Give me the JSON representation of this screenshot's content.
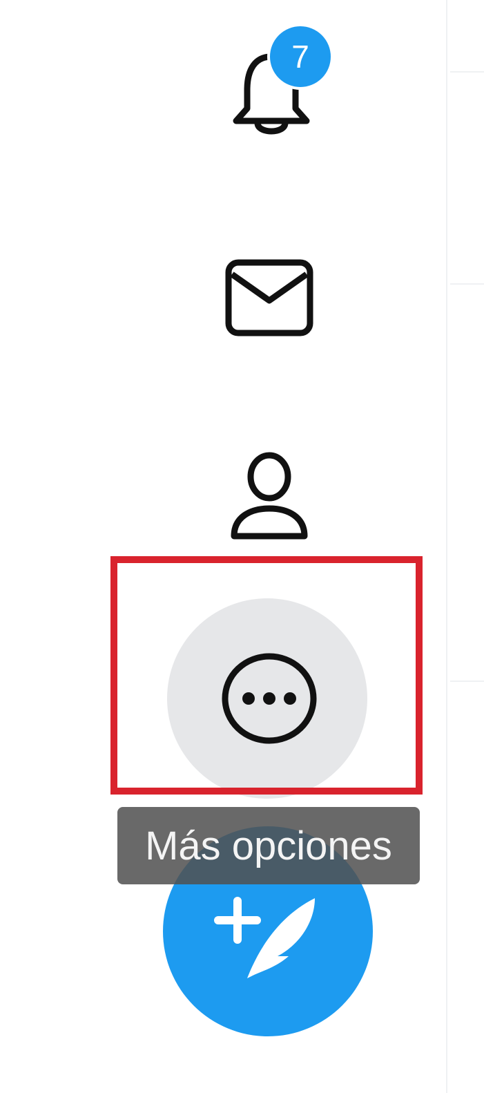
{
  "nav": {
    "notifications": {
      "icon": "bell-icon",
      "badge_count": "7"
    },
    "messages": {
      "icon": "envelope-icon"
    },
    "profile": {
      "icon": "person-icon"
    },
    "more": {
      "icon": "more-options-icon",
      "tooltip": "Más opciones"
    }
  },
  "compose": {
    "icon": "compose-feather-plus-icon"
  },
  "colors": {
    "accent": "#1d9bf0",
    "highlight_border": "#d9232d",
    "hover_circle": "#e6e7e9",
    "tooltip_bg": "#505050"
  }
}
